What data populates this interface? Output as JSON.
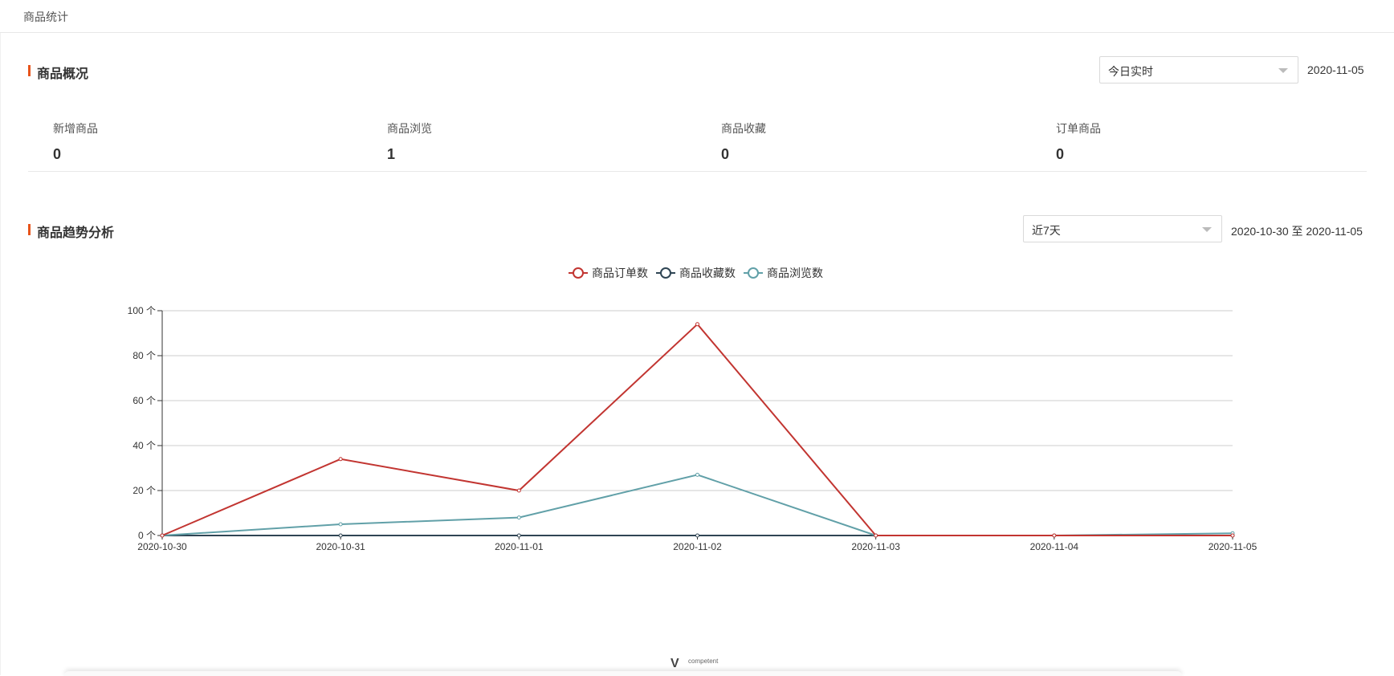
{
  "page": {
    "breadcrumb": "商品统计"
  },
  "overview": {
    "title": "商品概况",
    "range_select": "今日实时",
    "date": "2020-11-05",
    "stats": [
      {
        "label": "新增商品",
        "value": "0"
      },
      {
        "label": "商品浏览",
        "value": "1"
      },
      {
        "label": "商品收藏",
        "value": "0"
      },
      {
        "label": "订单商品",
        "value": "0"
      }
    ]
  },
  "trend": {
    "title": "商品趋势分析",
    "range_select": "近7天",
    "date_range": "2020-10-30 至 2020-11-05"
  },
  "footer": {
    "logo_text": "competent"
  },
  "colors": {
    "accent": "#e8541b",
    "orders": "#c23531",
    "favorites": "#2f4554",
    "views": "#61a0a8"
  },
  "chart_data": {
    "type": "line",
    "x": [
      "2020-10-30",
      "2020-10-31",
      "2020-11-01",
      "2020-11-02",
      "2020-11-03",
      "2020-11-04",
      "2020-11-05"
    ],
    "series": [
      {
        "name": "商品订单数",
        "values": [
          0,
          34,
          20,
          94,
          0,
          0,
          0
        ]
      },
      {
        "name": "商品收藏数",
        "values": [
          0,
          0,
          0,
          0,
          0,
          0,
          0
        ]
      },
      {
        "name": "商品浏览数",
        "values": [
          0,
          5,
          8,
          27,
          0,
          0,
          1
        ]
      }
    ],
    "y_ticks": [
      "0 个",
      "20 个",
      "40 个",
      "60 个",
      "80 个",
      "100 个"
    ],
    "ylim": [
      0,
      100
    ],
    "grid": true,
    "legend": "top-center"
  }
}
